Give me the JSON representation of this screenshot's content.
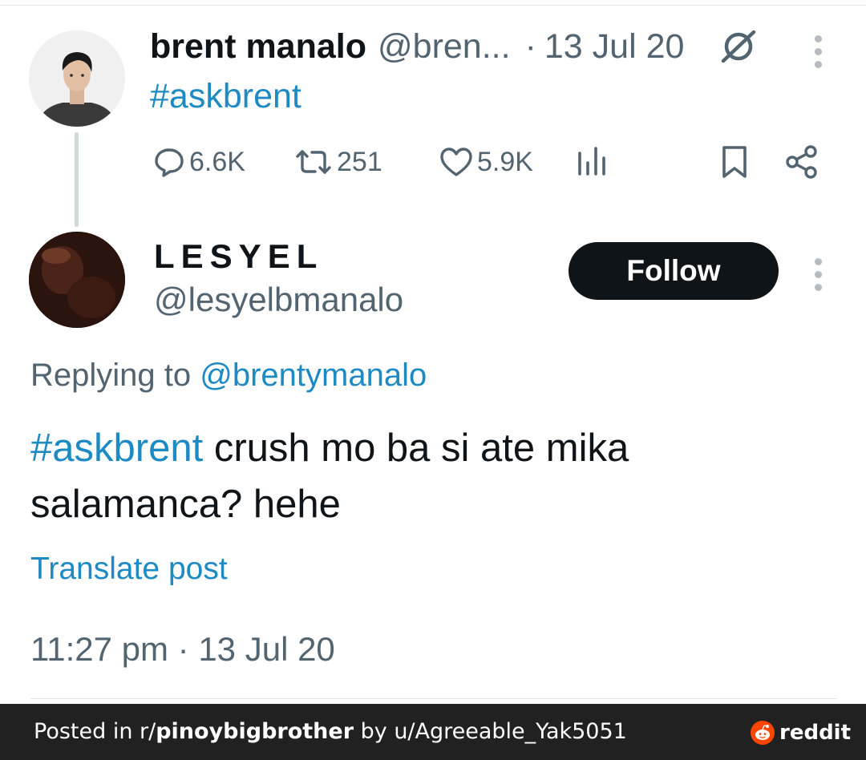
{
  "parent_post": {
    "author_name": "brent manalo",
    "author_handle": "@bren...",
    "separator": "·",
    "date": "13 Jul 20",
    "text": "#askbrent",
    "actions": {
      "replies": "6.6K",
      "reposts": "251",
      "likes": "5.9K"
    },
    "icons": [
      "grok-icon",
      "more-options-icon",
      "reply-icon",
      "repost-icon",
      "like-icon",
      "views-icon",
      "bookmark-icon",
      "share-icon"
    ]
  },
  "reply_post": {
    "author_name": "LESYEL",
    "author_handle": "@lesyelbmanalo",
    "follow_label": "Follow",
    "replying_prefix": "Replying to",
    "replying_to": "@brentymanalo",
    "hashtag": "#askbrent",
    "body": " crush mo ba si ate mika salamanca? hehe",
    "translate_label": "Translate post",
    "timestamp": "11:27 pm · 13 Jul 20"
  },
  "footer": {
    "posted_in_prefix": "Posted in r/",
    "subreddit": "pinoybigbrother",
    "by_prefix": " by u/",
    "username": "Agreeable_Yak5051",
    "brand": "reddit"
  },
  "colors": {
    "link": "#1d8ac4",
    "secondary_text": "#536471",
    "primary_text": "#0f1419",
    "follow_button_bg": "#0f1419",
    "footer_bg": "#212121",
    "reddit_orange": "#ff4500"
  }
}
